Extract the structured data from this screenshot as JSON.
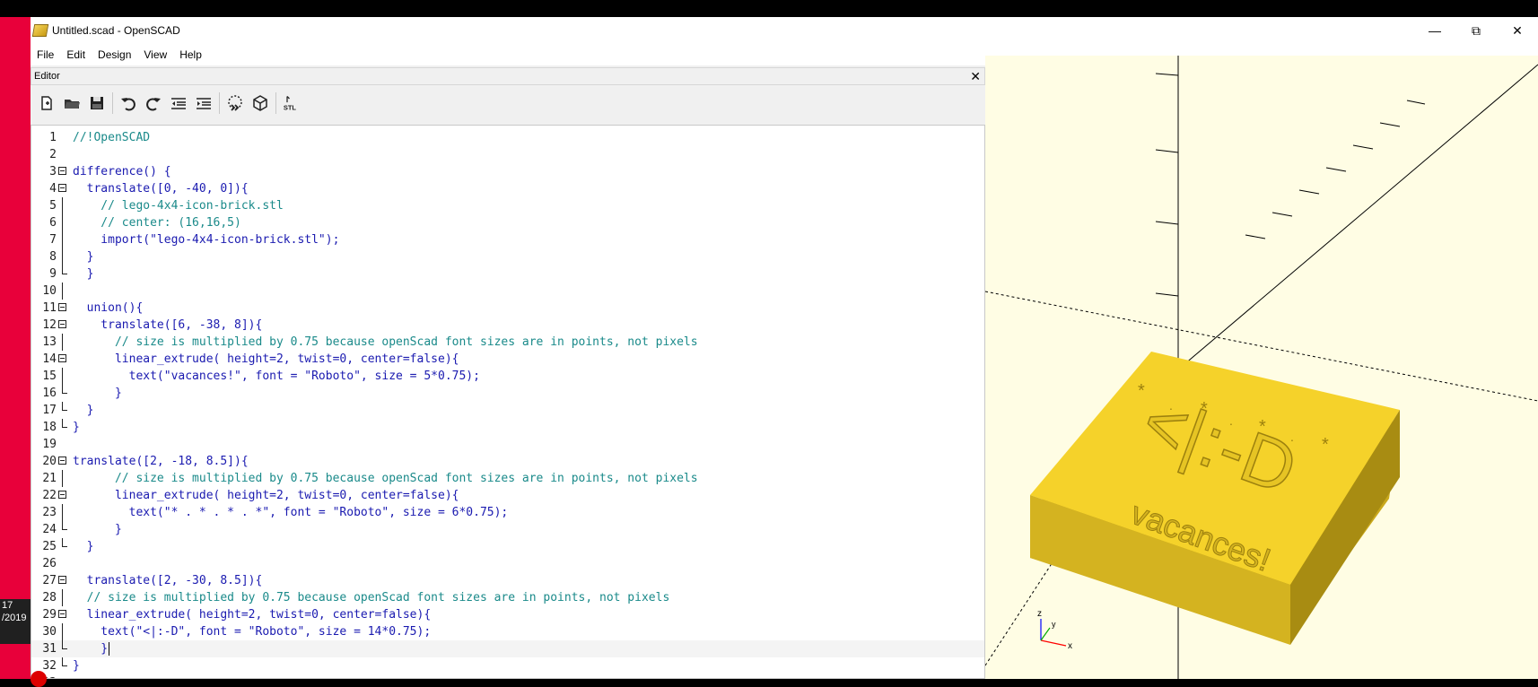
{
  "window": {
    "title": "Untitled.scad - OpenSCAD",
    "minimize": "—",
    "restore": "⧉",
    "close": "✕"
  },
  "menu": [
    "File",
    "Edit",
    "Design",
    "View",
    "Help"
  ],
  "editor": {
    "dock_title": "Editor",
    "dock_close": "✕",
    "toolbar": [
      "new",
      "open",
      "save",
      "undo",
      "redo",
      "unindent",
      "indent",
      "preview",
      "render",
      "export-stl"
    ],
    "stl_label": "STL",
    "lines": [
      "//!OpenSCAD",
      "",
      "difference() {",
      "  translate([0, -40, 0]){",
      "    // lego-4x4-icon-brick.stl",
      "    // center: (16,16,5)",
      "    import(\"lego-4x4-icon-brick.stl\");",
      "  }",
      "  }",
      "",
      "  union(){",
      "    translate([6, -38, 8]){",
      "      // size is multiplied by 0.75 because openScad font sizes are in points, not pixels",
      "      linear_extrude( height=2, twist=0, center=false){",
      "        text(\"vacances!\", font = \"Roboto\", size = 5*0.75);",
      "      }",
      "  }",
      "}",
      "",
      "translate([2, -18, 8.5]){",
      "      // size is multiplied by 0.75 because openScad font sizes are in points, not pixels",
      "      linear_extrude( height=2, twist=0, center=false){",
      "        text(\"* . * . * . *\", font = \"Roboto\", size = 6*0.75);",
      "      }",
      "  }",
      "",
      "  translate([2, -30, 8.5]){",
      "  // size is multiplied by 0.75 because openScad font sizes are in points, not pixels",
      "  linear_extrude( height=2, twist=0, center=false){",
      "    text(\"<|:-D\", font = \"Roboto\", size = 14*0.75);",
      "    }",
      "}",
      ""
    ],
    "folds": [
      3,
      4,
      11,
      12,
      14,
      20,
      22,
      27,
      29
    ]
  },
  "taskbar": {
    "time": "17",
    "date": "/2019"
  },
  "viewport": {
    "axis_x": "x",
    "axis_y": "y",
    "axis_z": "z",
    "model_text": "vacances!",
    "model_icon": "<|:-D",
    "model_color": "#f5d22a"
  }
}
